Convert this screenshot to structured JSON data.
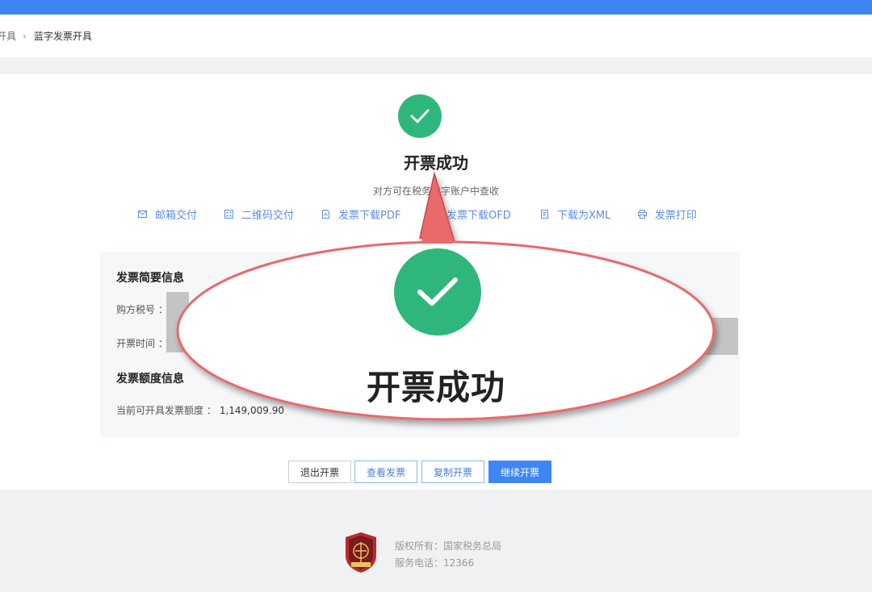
{
  "colors": {
    "accent": "#3d86f3",
    "success": "#2fb67c",
    "link": "#5b8ee6",
    "callout_red": "#e86a6a"
  },
  "breadcrumb": {
    "prev": "开具",
    "current": "蓝字发票开具"
  },
  "result": {
    "icon": "check-circle-icon",
    "title": "开票成功",
    "description": "对方可在税务数字账户中查收"
  },
  "actions": [
    {
      "label": "邮箱交付",
      "icon": "mail-icon"
    },
    {
      "label": "二维码交付",
      "icon": "qrcode-icon"
    },
    {
      "label": "发票下载PDF",
      "icon": "file-pdf-icon"
    },
    {
      "label": "发票下载OFD",
      "icon": "file-ofd-icon"
    },
    {
      "label": "下载为XML",
      "icon": "file-xml-icon"
    },
    {
      "label": "发票打印",
      "icon": "printer-icon"
    }
  ],
  "summary": {
    "title": "发票简要信息",
    "buyer_tax_label": "购方税号 ：",
    "issue_time_label": "开票时间 ：",
    "quota_title": "发票额度信息",
    "quota_label": "当前可开具发票额度 ：",
    "quota_value": "1,149,009.90"
  },
  "buttons": {
    "exit": "退出开票",
    "view": "查看发票",
    "copy": "复制开票",
    "continue": "继续开票"
  },
  "footer": {
    "copyright": "版权所有：国家税务总局",
    "phone": "服务电话：12366"
  },
  "callout": {
    "title": "开票成功"
  }
}
